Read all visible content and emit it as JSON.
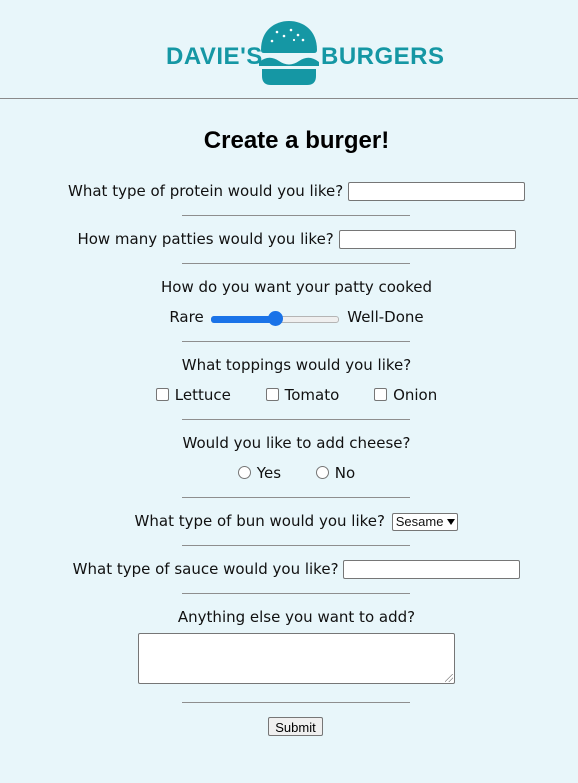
{
  "header": {
    "logo_left": "DAVIE'S",
    "logo_right": "BURGERS",
    "brand_color": "#1597a4",
    "logo_icon": "burger-icon"
  },
  "form": {
    "title": "Create a burger!",
    "protein": {
      "label": "What type of protein would you like?",
      "value": ""
    },
    "patties": {
      "label": "How many patties would you like?",
      "value": ""
    },
    "cooked": {
      "label": "How do you want your patty cooked",
      "min_label": "Rare",
      "max_label": "Well-Done",
      "level": 0.5
    },
    "toppings": {
      "label": "What toppings would you like?",
      "options": [
        "Lettuce",
        "Tomato",
        "Onion"
      ]
    },
    "cheese": {
      "label": "Would you like to add cheese?",
      "options": [
        "Yes",
        "No"
      ]
    },
    "bun": {
      "label": "What type of bun would you like?",
      "selected": "Sesame"
    },
    "sauce": {
      "label": "What type of sauce would you like?",
      "value": ""
    },
    "extra": {
      "label": "Anything else you want to add?",
      "value": ""
    },
    "submit_label": "Submit",
    "accent_color": "#1a73e8"
  }
}
